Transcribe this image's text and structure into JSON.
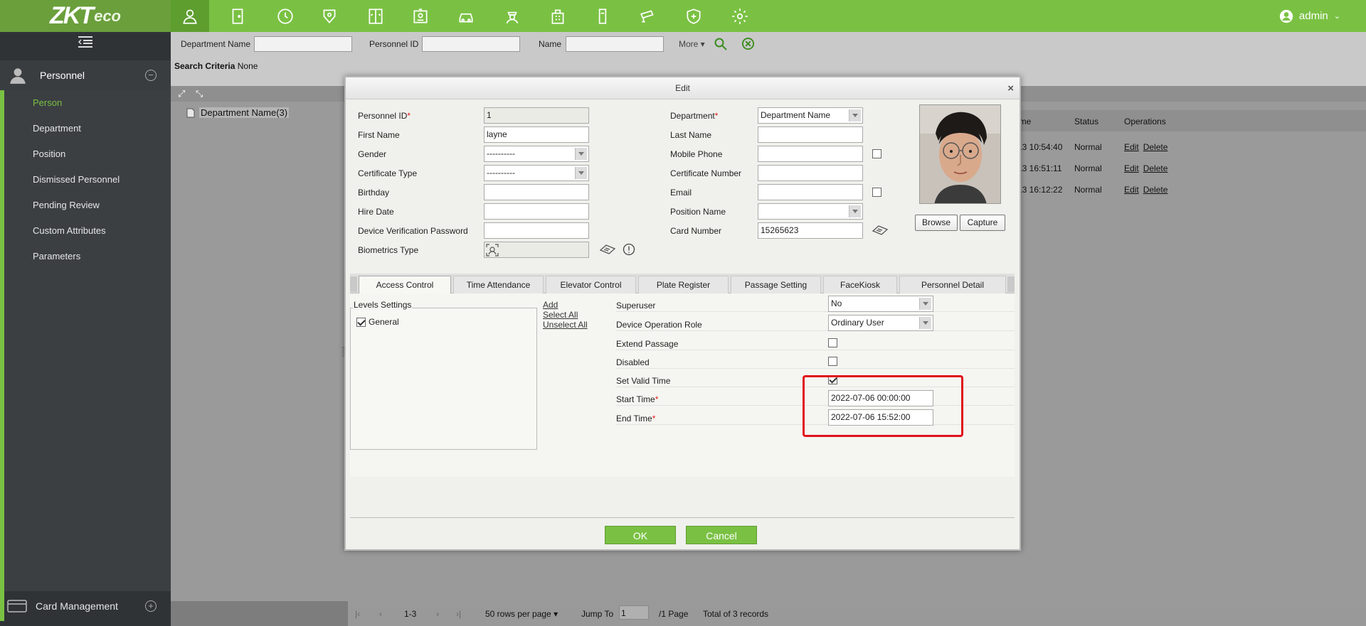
{
  "brand": {
    "logo_main": "ZKT",
    "logo_sub": "eco"
  },
  "user": {
    "name": "admin"
  },
  "nav_icons": [
    "person-icon",
    "door-icon",
    "clock-icon",
    "elevator-access-icon",
    "elevator-icon",
    "badge-icon",
    "car-icon",
    "guard-icon",
    "building-icon",
    "turnstile-icon",
    "camera-icon",
    "shield-icon",
    "gear-icon"
  ],
  "sidebar": {
    "module": "Personnel",
    "items": [
      {
        "label": "Person",
        "active": true
      },
      {
        "label": "Department"
      },
      {
        "label": "Position"
      },
      {
        "label": "Dismissed Personnel"
      },
      {
        "label": "Pending Review"
      },
      {
        "label": "Custom Attributes"
      },
      {
        "label": "Parameters"
      }
    ],
    "card_management": "Card Management"
  },
  "search": {
    "department_label": "Department Name",
    "personnel_id_label": "Personnel ID",
    "name_label": "Name",
    "more": "More",
    "criteria_label": "Search Criteria",
    "criteria_value": "None"
  },
  "tree": {
    "node": "Department Name(3)"
  },
  "grid": {
    "headers": {
      "time": "ime",
      "status": "Status",
      "operations": "Operations"
    },
    "rows": [
      {
        "time": "13 10:54:40",
        "status": "Normal"
      },
      {
        "time": "13 16:51:11",
        "status": "Normal"
      },
      {
        "time": "13 16:12:22",
        "status": "Normal"
      }
    ],
    "edit": "Edit",
    "delete": "Delete"
  },
  "pager": {
    "range": "1-3",
    "rows_per_page": "50 rows per page",
    "jump_to": "Jump To",
    "page_value": "1",
    "page_total": "/1 Page",
    "total": "Total of 3 records"
  },
  "dialog": {
    "title": "Edit",
    "close": "×",
    "fields": {
      "personnel_id": {
        "label": "Personnel ID",
        "value": "1"
      },
      "first_name": {
        "label": "First Name",
        "value": "layne"
      },
      "gender": {
        "label": "Gender",
        "value": "----------"
      },
      "certificate_type": {
        "label": "Certificate Type",
        "value": "----------"
      },
      "birthday": {
        "label": "Birthday",
        "value": ""
      },
      "hire_date": {
        "label": "Hire Date",
        "value": ""
      },
      "device_password": {
        "label": "Device Verification Password",
        "value": ""
      },
      "biometrics_type": {
        "label": "Biometrics Type"
      },
      "department": {
        "label": "Department",
        "value": "Department Name"
      },
      "last_name": {
        "label": "Last Name",
        "value": ""
      },
      "mobile_phone": {
        "label": "Mobile Phone",
        "value": ""
      },
      "certificate_number": {
        "label": "Certificate Number",
        "value": ""
      },
      "email": {
        "label": "Email",
        "value": ""
      },
      "position_name": {
        "label": "Position Name",
        "value": ""
      },
      "card_number": {
        "label": "Card Number",
        "value": "15265623"
      }
    },
    "buttons": {
      "browse": "Browse",
      "capture": "Capture",
      "ok": "OK",
      "cancel": "Cancel"
    },
    "tabs": [
      "Access Control",
      "Time Attendance",
      "Elevator Control",
      "Plate Register",
      "Passage Setting",
      "FaceKiosk",
      "Personnel Detail"
    ],
    "access_control": {
      "levels_settings": "Levels Settings",
      "levels": [
        {
          "label": "General",
          "checked": true
        }
      ],
      "links": {
        "add": "Add",
        "select_all": "Select All",
        "unselect_all": "Unselect All"
      },
      "superuser": {
        "label": "Superuser",
        "value": "No"
      },
      "device_role": {
        "label": "Device Operation Role",
        "value": "Ordinary User"
      },
      "extend_passage": {
        "label": "Extend Passage",
        "checked": false
      },
      "disabled": {
        "label": "Disabled",
        "checked": false
      },
      "set_valid_time": {
        "label": "Set Valid Time",
        "checked": true
      },
      "start_time": {
        "label": "Start Time",
        "value": "2022-07-06 00:00:00"
      },
      "end_time": {
        "label": "End Time",
        "value": "2022-07-06 15:52:00"
      }
    }
  },
  "colors": {
    "brand_green": "#7ac143",
    "highlight_red": "#e0121b",
    "sidebar_dark": "#2f3336"
  }
}
